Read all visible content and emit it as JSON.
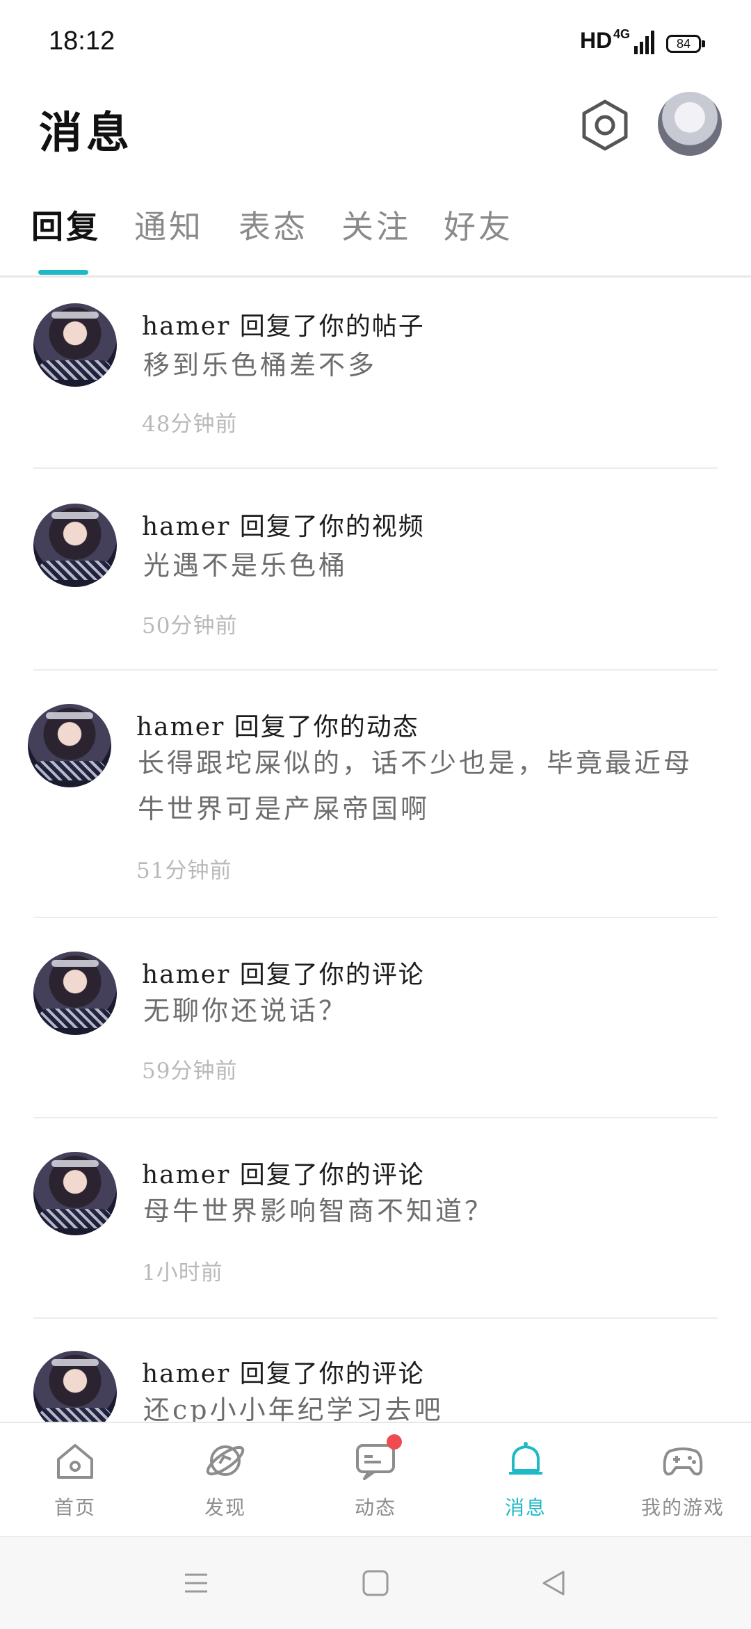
{
  "status_bar": {
    "time": "18:12",
    "network": "HD",
    "signal": "4G",
    "battery": "84"
  },
  "header": {
    "title": "消息"
  },
  "tabs": [
    {
      "label": "回复",
      "active": true
    },
    {
      "label": "通知",
      "active": false
    },
    {
      "label": "表态",
      "active": false
    },
    {
      "label": "关注",
      "active": false
    },
    {
      "label": "好友",
      "active": false
    }
  ],
  "messages": [
    {
      "title": "hamer 回复了你的帖子",
      "body": "移到乐色桶差不多",
      "time": "48分钟前"
    },
    {
      "title": "hamer 回复了你的视频",
      "body": "光遇不是乐色桶",
      "time": "50分钟前"
    },
    {
      "title": "hamer 回复了你的动态",
      "body": "长得跟坨屎似的，话不少也是，毕竟最近母牛世界可是产屎帝国啊",
      "time": "51分钟前"
    },
    {
      "title": "hamer 回复了你的评论",
      "body": "无聊你还说话？",
      "time": "59分钟前"
    },
    {
      "title": "hamer 回复了你的评论",
      "body": "母牛世界影响智商不知道？",
      "time": "1小时前"
    },
    {
      "title": "hamer 回复了你的评论",
      "body": "还cp小小年纪学习去吧",
      "time": ""
    }
  ],
  "bottom_nav": [
    {
      "label": "首页",
      "icon": "home-icon",
      "active": false
    },
    {
      "label": "发现",
      "icon": "planet-icon",
      "active": false
    },
    {
      "label": "动态",
      "icon": "chat-icon",
      "active": false,
      "badge": true
    },
    {
      "label": "消息",
      "icon": "bell-icon",
      "active": true
    },
    {
      "label": "我的游戏",
      "icon": "gamepad-icon",
      "active": false
    }
  ],
  "colors": {
    "accent": "#1fb8c6",
    "badge": "#f04b50",
    "muted": "#b9b9b9"
  }
}
